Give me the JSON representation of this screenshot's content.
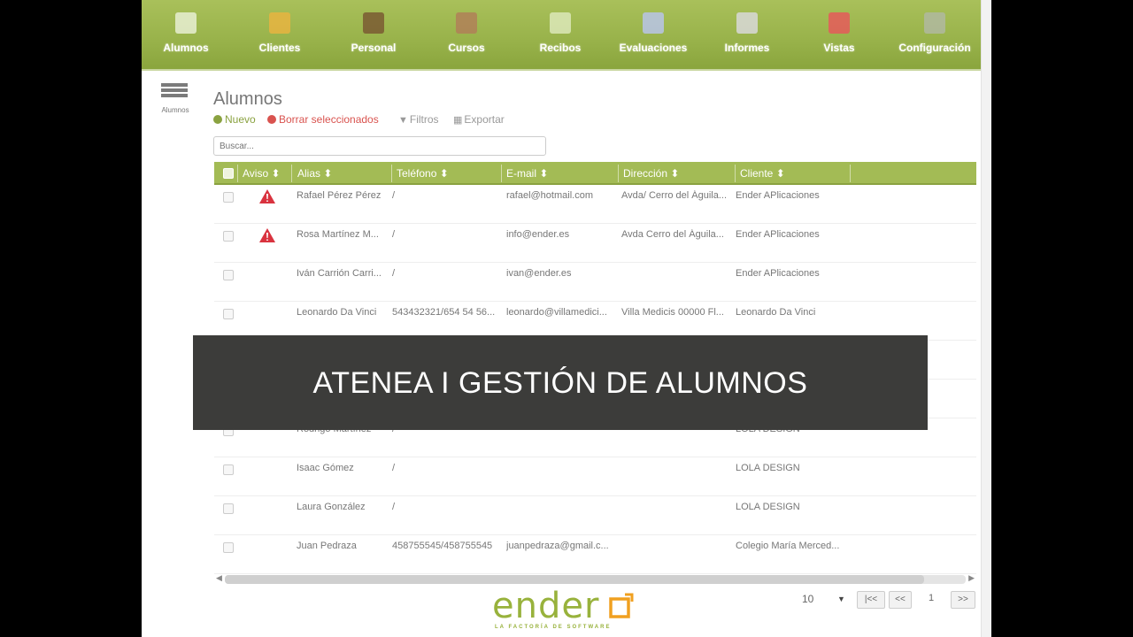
{
  "nav": {
    "items": [
      {
        "label": "Alumnos",
        "icon": "students-icon"
      },
      {
        "label": "Clientes",
        "icon": "clients-icon"
      },
      {
        "label": "Personal",
        "icon": "staff-briefcase-icon"
      },
      {
        "label": "Cursos",
        "icon": "courses-book-icon"
      },
      {
        "label": "Recibos",
        "icon": "receipts-money-icon"
      },
      {
        "label": "Evaluaciones",
        "icon": "evaluations-icon"
      },
      {
        "label": "Informes",
        "icon": "reports-printer-icon"
      },
      {
        "label": "Vistas",
        "icon": "views-window-icon"
      },
      {
        "label": "Configuración",
        "icon": "settings-gear-icon"
      }
    ]
  },
  "sidebar": {
    "label": "Alumnos",
    "icon": "list-icon"
  },
  "page": {
    "title": "Alumnos"
  },
  "toolbar": {
    "new_label": "Nuevo",
    "delete_label": "Borrar seleccionados",
    "filters_label": "Filtros",
    "export_label": "Exportar"
  },
  "search": {
    "placeholder": "Buscar..."
  },
  "table": {
    "columns": [
      "Aviso ⬍",
      "Alias ⬍",
      "Teléfono ⬍",
      "E-mail ⬍",
      "Dirección ⬍",
      "Cliente ⬍"
    ],
    "rows": [
      {
        "warning": true,
        "alias": "Rafael Pérez Pérez",
        "phone": "/",
        "email": "rafael@hotmail.com",
        "address": "Avda/ Cerro del Águila...",
        "client": "Ender APlicaciones"
      },
      {
        "warning": true,
        "alias": "Rosa Martínez M...",
        "phone": "/",
        "email": "info@ender.es",
        "address": "Avda Cerro del Águila...",
        "client": "Ender APlicaciones"
      },
      {
        "warning": false,
        "alias": "Iván Carrión Carri...",
        "phone": "/",
        "email": "ivan@ender.es",
        "address": "",
        "client": "Ender APlicaciones"
      },
      {
        "warning": false,
        "alias": "Leonardo Da Vinci",
        "phone": "543432321/654 54 56...",
        "email": "leonardo@villamedici...",
        "address": "Villa Medicis 00000 Fl...",
        "client": "Leonardo Da Vinci"
      },
      {
        "warning": false,
        "alias": "",
        "phone": "",
        "email": "",
        "address": "",
        "client": ""
      },
      {
        "warning": false,
        "alias": "",
        "phone": "",
        "email": "",
        "address": "",
        "client": ""
      },
      {
        "warning": false,
        "alias": "Rodrigo Martínez",
        "phone": "/",
        "email": "",
        "address": "",
        "client": "LOLA DESIGN"
      },
      {
        "warning": false,
        "alias": "Isaac Gómez",
        "phone": "/",
        "email": "",
        "address": "",
        "client": "LOLA DESIGN"
      },
      {
        "warning": false,
        "alias": "Laura González",
        "phone": "/",
        "email": "",
        "address": "",
        "client": "LOLA DESIGN"
      },
      {
        "warning": false,
        "alias": "Juan Pedraza",
        "phone": "458755545/458755545",
        "email": "juanpedraza@gmail.c...",
        "address": "",
        "client": "Colegio María Merced..."
      }
    ]
  },
  "pagination": {
    "per_page": "10",
    "first": "|<<",
    "prev": "<<",
    "current": "1",
    "next": ">>"
  },
  "logo": {
    "text": "ender",
    "tagline": "LA FACTORÍA DE SOFTWARE"
  },
  "banner": {
    "text": "ATENEA I GESTIÓN DE ALUMNOS"
  },
  "colors": {
    "brand_green": "#98b23c",
    "header_green": "#a3bb55",
    "warning_red": "#d9333f",
    "delete_red": "#d9534f",
    "banner_bg": "#3c3c3a"
  }
}
